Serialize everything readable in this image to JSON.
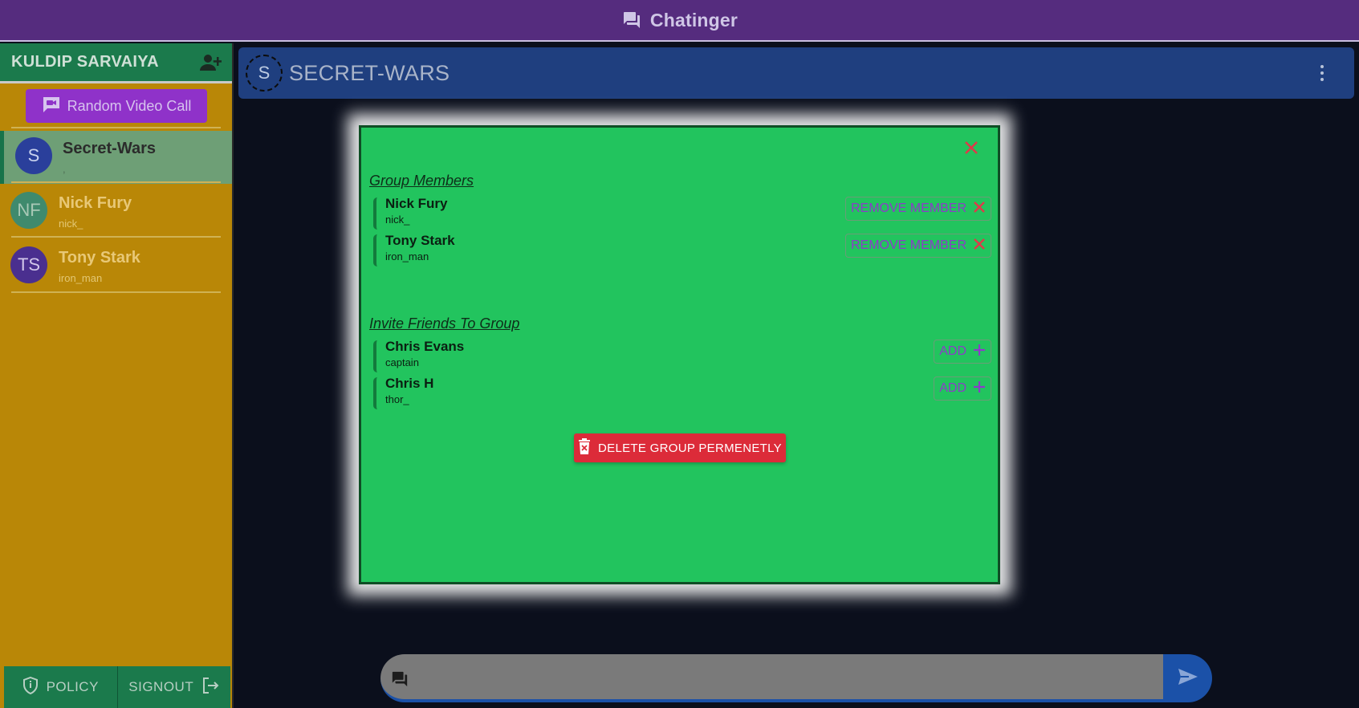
{
  "app": {
    "title": "Chatinger"
  },
  "sidebar": {
    "user_name": "KULDIP SARVAIYA",
    "random_video_call_label": "Random Video Call",
    "chats": [
      {
        "initials": "S",
        "name": "Secret-Wars",
        "subtitle": ",",
        "active": true,
        "avatar_color": "#2a3f9b"
      },
      {
        "initials": "NF",
        "name": "Nick Fury",
        "subtitle": "nick_",
        "active": false,
        "avatar_color": "#3f8a6d"
      },
      {
        "initials": "TS",
        "name": "Tony Stark",
        "subtitle": "iron_man",
        "active": false,
        "avatar_color": "#4a2f8f"
      }
    ],
    "footer": {
      "policy_label": "POLICY",
      "signout_label": "SIGNOUT"
    }
  },
  "header": {
    "group_initial": "S",
    "group_name": "SECRET-WARS"
  },
  "modal": {
    "members_title": "Group Members",
    "members": [
      {
        "name": "Nick Fury",
        "username": "nick_",
        "action_label": "REMOVE MEMBER"
      },
      {
        "name": "Tony Stark",
        "username": "iron_man",
        "action_label": "REMOVE MEMBER"
      }
    ],
    "invite_title": "Invite Friends To Group",
    "friends": [
      {
        "name": "Chris Evans",
        "username": "captain",
        "action_label": "ADD"
      },
      {
        "name": "Chris H",
        "username": "thor_",
        "action_label": "ADD"
      }
    ],
    "delete_label": "DELETE GROUP PERMENETLY"
  },
  "composer": {
    "value": ""
  },
  "colors": {
    "topbar": "#552c7e",
    "sidebar": "#b98707",
    "accent_green": "#1b7a4c",
    "modal_bg": "#22c45e",
    "danger": "#dc2b39",
    "header": "#1f3f7f",
    "send": "#1b51a8"
  }
}
